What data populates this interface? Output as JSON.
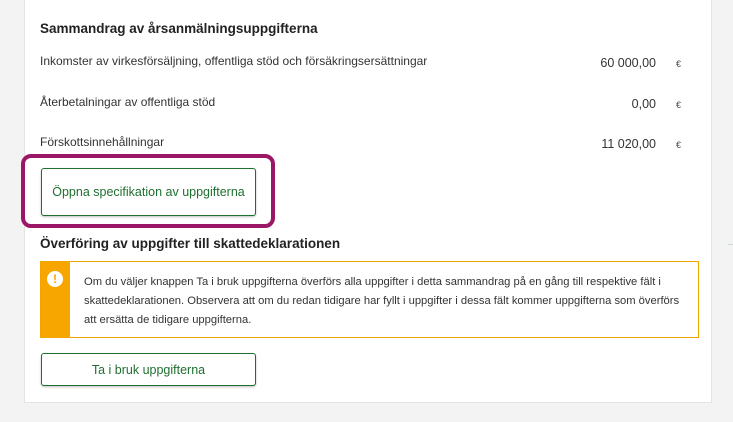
{
  "summary": {
    "title": "Sammandrag av årsanmälningsuppgifterna",
    "rows": [
      {
        "label": "Inkomster av virkesförsäljning, offentliga stöd och försäkringsersättningar",
        "value": "60 000,00",
        "unit": "€"
      },
      {
        "label": "Återbetalningar av offentliga stöd",
        "value": "0,00",
        "unit": "€"
      },
      {
        "label": "Förskottsinnehållningar",
        "value": "11 020,00",
        "unit": "€"
      }
    ],
    "open_spec_button": "Öppna specifikation av uppgifterna"
  },
  "transfer": {
    "title": "Överföring av uppgifter till skattedeklarationen",
    "warning_icon": "exclamation-icon",
    "warning_text": "Om du väljer knappen Ta i bruk uppgifterna överförs alla uppgifter i detta sammandrag på en gång till respektive fält i skattedeklarationen. Observera att om du redan tidigare har fyllt i uppgifter i dessa fält kommer uppgifterna som överförs att ersätta de tidigare uppgifterna.",
    "use_button": "Ta i bruk uppgifterna"
  },
  "colors": {
    "accent_green": "#1f6f2f",
    "highlight": "#9b1765",
    "warning": "#f7a600"
  }
}
